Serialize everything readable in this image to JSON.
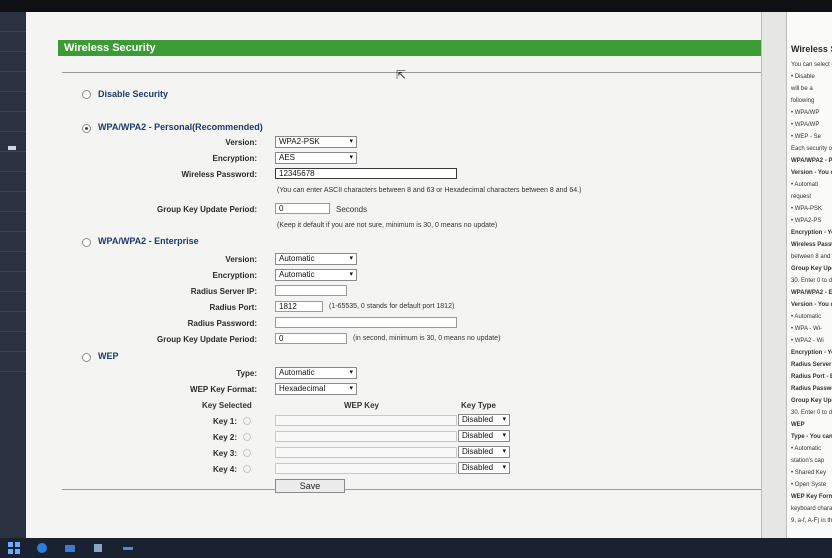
{
  "header": {
    "title": "Wireless Security"
  },
  "options": {
    "disable": {
      "label": "Disable Security"
    },
    "personal": {
      "label": "WPA/WPA2 - Personal(Recommended)",
      "version_label": "Version:",
      "version_value": "WPA2-PSK",
      "encryption_label": "Encryption:",
      "encryption_value": "AES",
      "password_label": "Wireless Password:",
      "password_value": "12345678",
      "password_hint": "(You can enter ASCII characters between 8 and 63 or Hexadecimal characters between 8 and 64.)",
      "gkup_label": "Group Key Update Period:",
      "gkup_value": "0",
      "gkup_unit": "Seconds",
      "gkup_hint": "(Keep it default if you are not sure, minimum is 30, 0 means no update)"
    },
    "enterprise": {
      "label": "WPA/WPA2 - Enterprise",
      "version_label": "Version:",
      "version_value": "Automatic",
      "encryption_label": "Encryption:",
      "encryption_value": "Automatic",
      "radius_ip_label": "Radius Server IP:",
      "radius_ip_value": "",
      "radius_port_label": "Radius Port:",
      "radius_port_value": "1812",
      "radius_port_hint": "(1-65535, 0 stands for default port 1812)",
      "radius_pw_label": "Radius Password:",
      "radius_pw_value": "",
      "gkup_label": "Group Key Update Period:",
      "gkup_value": "0",
      "gkup_hint": "(in second, minimum is 30, 0 means no update)"
    },
    "wep": {
      "label": "WEP",
      "type_label": "Type:",
      "type_value": "Automatic",
      "format_label": "WEP Key Format:",
      "format_value": "Hexadecimal",
      "col_selected": "Key Selected",
      "col_key": "WEP Key",
      "col_type": "Key Type",
      "keys": [
        {
          "label": "Key 1:",
          "value": "",
          "type": "Disabled"
        },
        {
          "label": "Key 2:",
          "value": "",
          "type": "Disabled"
        },
        {
          "label": "Key 3:",
          "value": "",
          "type": "Disabled"
        },
        {
          "label": "Key 4:",
          "value": "",
          "type": "Disabled"
        }
      ]
    }
  },
  "save_label": "Save",
  "help": {
    "title": "Wireless Se",
    "lines": [
      "You can select o",
      "• Disable",
      "will be a",
      "following",
      "• WPA/WP",
      "• WPA/WP",
      "• WEP - Se",
      "Each security opt",
      "WPA/WPA2 - Pe",
      "Version - You ca",
      "• Automati",
      "request",
      "• WPA-PSK",
      "• WPA2-PS",
      "Encryption - You",
      "Wireless Passw",
      "between 8 and 64",
      "Group Key Upda",
      "30. Enter 0 to disa",
      "WPA/WPA2 - Ent",
      "Version - You car",
      "• Automatic",
      "• WPA - Wi-",
      "• WPA2 - Wi",
      "Encryption - You",
      "Radius Server IP",
      "Radius Port - Ent",
      "Radius Password",
      "Group Key Updat",
      "30. Enter 0 to disa",
      "WEP",
      "Type - You can sele",
      "• Automatic",
      "station's cap",
      "• Shared Key",
      "• Open Syste",
      "WEP Key Format",
      "keyboard characters",
      "9, a-f, A-F) in the sp"
    ]
  },
  "colors": {
    "header_green": "#3c9b35",
    "section_blue": "#1e3a6e"
  }
}
